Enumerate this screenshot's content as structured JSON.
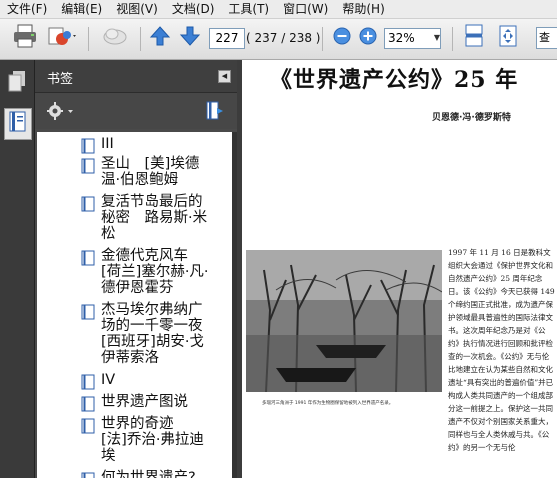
{
  "menubar": {
    "items": [
      "文件(F)",
      "编辑(E)",
      "视图(V)",
      "文档(D)",
      "工具(T)",
      "窗口(W)",
      "帮助(H)"
    ]
  },
  "toolbar": {
    "current_page": "227",
    "page_count": "( 237 / 238 )",
    "zoom": "32%",
    "search_value": "查"
  },
  "bookmarks_panel": {
    "title": "书签",
    "items": [
      "III",
      "圣山　[美]埃德温·伯恩鲍姆",
      "复活节岛最后的秘密　路易斯·米松",
      "金德代克风车　[荷兰]塞尔赫·凡·德伊恩霍芬",
      "杰马埃尔弗纳广场的一千零一夜　[西班牙]胡安·戈伊蒂索洛",
      "IV",
      "世界遗产图说",
      "世界的奇迹　[法]乔治·弗拉迪埃",
      "何为世界遗产?"
    ]
  },
  "document": {
    "title": "《世界遗产公约》25 年",
    "author": "贝恩德·冯·德罗斯特",
    "photo_caption": "多瑙河三角洲于 1991 年作为生物圈保留地被列入世界遗产名录。",
    "body_text": "1997 年 11 月 16 日是教科文组织大会通过《保护世界文化和自然遗产公约》25 周年纪念日。该《公约》今天已获得 149 个缔约国正式批准，成为遗产保护领域最具普遍性的国际法律文书。这次周年纪念乃是对《公约》执行情况进行回顾和批评检查的一次机会。《公约》无与伦比地建立在认为某些自然和文化遗址“具有突出的普遍价值”并已构成人类共同遗产的一个组成部分这一前提之上。保护这一共同遗产不仅对个别国家关系重大，同样也与全人类休戚与共。《公约》的另一个无与伦"
  }
}
